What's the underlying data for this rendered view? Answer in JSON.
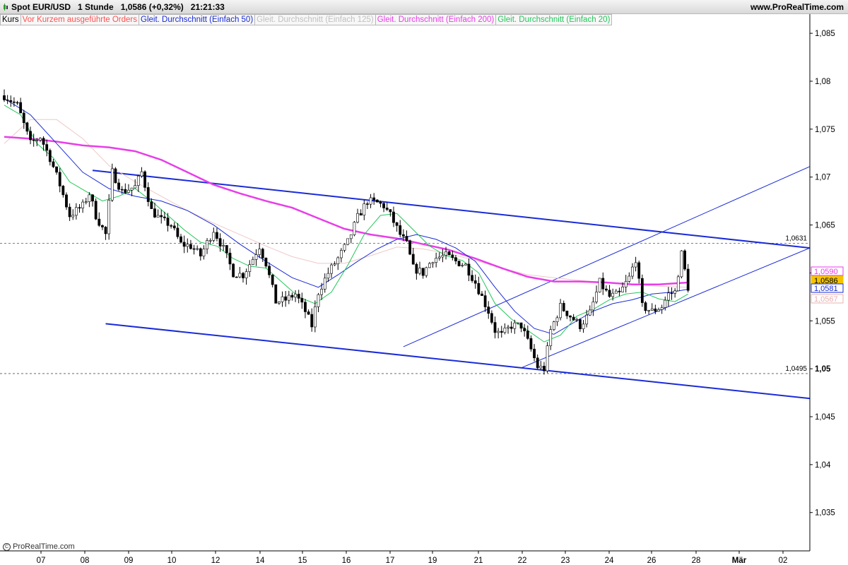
{
  "header": {
    "instrument": "Spot EUR/USD",
    "timeframe": "1 Stunde",
    "price_change": "1,0586 (+0,32%)",
    "time": "21:21:33",
    "site": "www.ProRealTime.com"
  },
  "legend": [
    {
      "label": "Kurs",
      "color": "#000000"
    },
    {
      "label": "Vor Kurzem ausgeführte Orders",
      "color": "#ff5050"
    },
    {
      "label": "Gleit. Durchschnitt (Einfach 50)",
      "color": "#1a2bd6"
    },
    {
      "label": "Gleit. Durchschnitt (Einfach 125)",
      "color": "#c8c8c8"
    },
    {
      "label": "Gleit. Durchschnitt (Einfach 200)",
      "color": "#e83ee8"
    },
    {
      "label": "Gleit. Durchschnitt (Einfach 20)",
      "color": "#22c75a"
    }
  ],
  "footer": {
    "copyright": "ProRealTime.com"
  },
  "chart_data": {
    "type": "candlestick",
    "y_axis": {
      "min": 1.031,
      "max": 1.087,
      "ticks": [
        "1,035",
        "1,04",
        "1,045",
        "1,05",
        "1,055",
        "1,06",
        "1,065",
        "1,07",
        "1,075",
        "1,08",
        "1,085"
      ],
      "bold_tick": "1,05"
    },
    "x_axis": {
      "labels": [
        "07",
        "08",
        "09",
        "10",
        "12",
        "14",
        "15",
        "16",
        "17",
        "19",
        "21",
        "22",
        "23",
        "24",
        "26",
        "28",
        "Mär",
        "02"
      ]
    },
    "horizontal_levels": [
      {
        "value": 1.0631,
        "label": "1,0631"
      },
      {
        "value": 1.0495,
        "label": "1,0495"
      }
    ],
    "price_tags": [
      {
        "label": "1,0590",
        "value": 1.059,
        "color": "#e83ee8",
        "style": "outline"
      },
      {
        "label": "1,0586",
        "value": 1.0586,
        "color": "#f5c400",
        "style": "filled"
      },
      {
        "label": "1,0581",
        "value": 1.0581,
        "color": "#1a2bd6",
        "style": "outline"
      },
      {
        "label": "1,0567",
        "value": 1.0567,
        "color": "#e8b0b0",
        "style": "outline"
      }
    ],
    "price_path": [
      [
        0,
        1.0785
      ],
      [
        4,
        1.0775
      ],
      [
        8,
        1.0735
      ],
      [
        11,
        1.0742
      ],
      [
        14,
        1.072
      ],
      [
        17,
        1.0692
      ],
      [
        20,
        1.066
      ],
      [
        24,
        1.067
      ],
      [
        26,
        1.0683
      ],
      [
        28,
        1.066
      ],
      [
        31,
        1.064
      ],
      [
        33,
        1.0705
      ],
      [
        36,
        1.0685
      ],
      [
        40,
        1.069
      ],
      [
        42,
        1.0705
      ],
      [
        45,
        1.0665
      ],
      [
        48,
        1.0655
      ],
      [
        51,
        1.065
      ],
      [
        54,
        1.063
      ],
      [
        57,
        1.0628
      ],
      [
        60,
        1.0618
      ],
      [
        64,
        1.0645
      ],
      [
        67,
        1.0625
      ],
      [
        70,
        1.06
      ],
      [
        73,
        1.0598
      ],
      [
        76,
        1.0615
      ],
      [
        78,
        1.0628
      ],
      [
        80,
        1.061
      ],
      [
        83,
        1.057
      ],
      [
        86,
        1.0572
      ],
      [
        89,
        1.0578
      ],
      [
        92,
        1.056
      ],
      [
        94,
        1.0545
      ],
      [
        96,
        1.058
      ],
      [
        99,
        1.06
      ],
      [
        102,
        1.0615
      ],
      [
        105,
        1.0632
      ],
      [
        108,
        1.0658
      ],
      [
        111,
        1.0675
      ],
      [
        114,
        1.0673
      ],
      [
        116,
        1.067
      ],
      [
        118,
        1.066
      ],
      [
        121,
        1.064
      ],
      [
        123,
        1.063
      ],
      [
        125,
        1.0605
      ],
      [
        128,
        1.06
      ],
      [
        131,
        1.0615
      ],
      [
        135,
        1.0618
      ],
      [
        138,
        1.0612
      ],
      [
        141,
        1.0608
      ],
      [
        144,
        1.059
      ],
      [
        146,
        1.0575
      ],
      [
        148,
        1.056
      ],
      [
        150,
        1.054
      ],
      [
        152,
        1.0535
      ],
      [
        155,
        1.0545
      ],
      [
        158,
        1.0545
      ],
      [
        161,
        1.052
      ],
      [
        163,
        1.0502
      ],
      [
        165,
        1.05
      ],
      [
        167,
        1.054
      ],
      [
        170,
        1.0565
      ],
      [
        173,
        1.0555
      ],
      [
        176,
        1.0545
      ],
      [
        179,
        1.0558
      ],
      [
        182,
        1.059
      ],
      [
        185,
        1.0575
      ],
      [
        188,
        1.0578
      ],
      [
        191,
        1.0595
      ],
      [
        193,
        1.0615
      ],
      [
        195,
        1.0565
      ],
      [
        198,
        1.056
      ],
      [
        201,
        1.0565
      ],
      [
        203,
        1.0578
      ],
      [
        205,
        1.058
      ],
      [
        207,
        1.062
      ],
      [
        209,
        1.0585
      ]
    ],
    "trend_lines": [
      {
        "name": "falling-channel-upper",
        "from": [
          27,
          1.0707
        ],
        "to": [
          1146,
          1.0626
        ],
        "color": "#1a2bd6",
        "width": 2
      },
      {
        "name": "falling-channel-lower",
        "from": [
          31,
          1.0547
        ],
        "to": [
          1146,
          1.0469
        ],
        "color": "#1a2bd6",
        "width": 2
      },
      {
        "name": "rising-channel-upper",
        "from": [
          122,
          1.0523
        ],
        "to": [
          1146,
          1.0711
        ],
        "color": "#1a2bd6",
        "width": 1
      },
      {
        "name": "rising-channel-lower",
        "from": [
          158,
          1.0501
        ],
        "to": [
          1146,
          1.0626
        ],
        "color": "#1a2bd6",
        "width": 1
      }
    ],
    "moving_averages": [
      {
        "name": "SMA 125",
        "color": "#f0c8c8",
        "width": 1,
        "points": [
          [
            0,
            1.0735
          ],
          [
            8,
            1.076
          ],
          [
            16,
            1.076
          ],
          [
            24,
            1.074
          ],
          [
            32,
            1.0712
          ],
          [
            40,
            1.0695
          ],
          [
            48,
            1.068
          ],
          [
            56,
            1.0665
          ],
          [
            64,
            1.0652
          ],
          [
            72,
            1.064
          ],
          [
            80,
            1.0628
          ],
          [
            88,
            1.0617
          ],
          [
            96,
            1.061
          ],
          [
            104,
            1.061
          ],
          [
            112,
            1.0618
          ],
          [
            120,
            1.0627
          ],
          [
            128,
            1.0625
          ],
          [
            136,
            1.062
          ],
          [
            144,
            1.0613
          ],
          [
            152,
            1.0605
          ],
          [
            160,
            1.0598
          ],
          [
            168,
            1.0595
          ],
          [
            176,
            1.0592
          ],
          [
            184,
            1.059
          ],
          [
            192,
            1.0588
          ],
          [
            200,
            1.0586
          ],
          [
            209,
            1.0585
          ]
        ]
      },
      {
        "name": "SMA 200",
        "color": "#e83ee8",
        "width": 2.5,
        "points": [
          [
            0,
            1.0742
          ],
          [
            8,
            1.074
          ],
          [
            16,
            1.0737
          ],
          [
            24,
            1.0733
          ],
          [
            32,
            1.0731
          ],
          [
            40,
            1.0727
          ],
          [
            48,
            1.0718
          ],
          [
            56,
            1.0705
          ],
          [
            64,
            1.0692
          ],
          [
            72,
            1.0683
          ],
          [
            80,
            1.0675
          ],
          [
            88,
            1.0668
          ],
          [
            96,
            1.0657
          ],
          [
            104,
            1.0646
          ],
          [
            112,
            1.064
          ],
          [
            120,
            1.0636
          ],
          [
            128,
            1.063
          ],
          [
            136,
            1.0624
          ],
          [
            144,
            1.0615
          ],
          [
            152,
            1.0605
          ],
          [
            160,
            1.0596
          ],
          [
            168,
            1.0591
          ],
          [
            176,
            1.0591
          ],
          [
            184,
            1.059
          ],
          [
            192,
            1.0588
          ],
          [
            200,
            1.0588
          ],
          [
            209,
            1.059
          ]
        ]
      },
      {
        "name": "SMA 50",
        "color": "#1a2bd6",
        "width": 1,
        "points": [
          [
            0,
            1.0782
          ],
          [
            8,
            1.0765
          ],
          [
            16,
            1.0735
          ],
          [
            24,
            1.0705
          ],
          [
            32,
            1.0688
          ],
          [
            40,
            1.068
          ],
          [
            48,
            1.0675
          ],
          [
            56,
            1.0665
          ],
          [
            64,
            1.065
          ],
          [
            72,
            1.063
          ],
          [
            80,
            1.0612
          ],
          [
            88,
            1.0595
          ],
          [
            96,
            1.0585
          ],
          [
            102,
            1.0598
          ],
          [
            108,
            1.0612
          ],
          [
            114,
            1.0625
          ],
          [
            120,
            1.0635
          ],
          [
            126,
            1.064
          ],
          [
            132,
            1.0635
          ],
          [
            138,
            1.0626
          ],
          [
            144,
            1.0612
          ],
          [
            150,
            1.0585
          ],
          [
            156,
            1.056
          ],
          [
            162,
            1.0542
          ],
          [
            168,
            1.0536
          ],
          [
            174,
            1.0548
          ],
          [
            180,
            1.056
          ],
          [
            186,
            1.0568
          ],
          [
            192,
            1.0572
          ],
          [
            198,
            1.0578
          ],
          [
            204,
            1.058
          ],
          [
            209,
            1.0583
          ]
        ]
      },
      {
        "name": "SMA 20",
        "color": "#22c75a",
        "width": 1,
        "points": [
          [
            0,
            1.0775
          ],
          [
            5,
            1.0765
          ],
          [
            10,
            1.0735
          ],
          [
            15,
            1.072
          ],
          [
            20,
            1.0695
          ],
          [
            25,
            1.0685
          ],
          [
            30,
            1.0675
          ],
          [
            35,
            1.068
          ],
          [
            40,
            1.0688
          ],
          [
            45,
            1.0675
          ],
          [
            50,
            1.066
          ],
          [
            55,
            1.0645
          ],
          [
            60,
            1.0632
          ],
          [
            65,
            1.0628
          ],
          [
            70,
            1.0615
          ],
          [
            75,
            1.0607
          ],
          [
            80,
            1.0605
          ],
          [
            85,
            1.059
          ],
          [
            90,
            1.0575
          ],
          [
            95,
            1.0568
          ],
          [
            100,
            1.058
          ],
          [
            105,
            1.0608
          ],
          [
            110,
            1.064
          ],
          [
            115,
            1.066
          ],
          [
            120,
            1.0662
          ],
          [
            125,
            1.0645
          ],
          [
            130,
            1.0628
          ],
          [
            135,
            1.0618
          ],
          [
            140,
            1.0613
          ],
          [
            145,
            1.06
          ],
          [
            150,
            1.0568
          ],
          [
            155,
            1.0552
          ],
          [
            160,
            1.054
          ],
          [
            165,
            1.0528
          ],
          [
            170,
            1.0535
          ],
          [
            175,
            1.0555
          ],
          [
            180,
            1.0562
          ],
          [
            185,
            1.0572
          ],
          [
            190,
            1.0578
          ],
          [
            195,
            1.058
          ],
          [
            200,
            1.0573
          ],
          [
            205,
            1.057
          ],
          [
            209,
            1.0578
          ]
        ]
      }
    ]
  }
}
